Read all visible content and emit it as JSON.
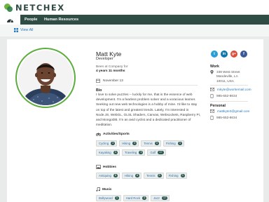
{
  "brand": {
    "name": "NETCHEX"
  },
  "nav": {
    "tabs": [
      "People",
      "Human Resources"
    ]
  },
  "subnav": {
    "view_all": "View All"
  },
  "profile": {
    "name": "Matt Kyte",
    "title": "Developer",
    "tenure_label": "Been at Company for",
    "tenure_value": "4 years 11 months",
    "birthday": "November 13",
    "bio_heading": "Bio",
    "bio": "I love to solve puzzles -- luckily for me, that is the essence of web development. I'm a fearless problem solver and a voracious learner. Seeking out new web technologies is a hobby of mine. I'd like to stay on top of the latest and greatest trends. Lately, I'm interested in Node.JS, WebGL, GLSL Shaders, Canvas, Websockets, Raspberry Pi, and MongoDB. I'm an avid cyclist and a dedicated practitioner of meditation."
  },
  "sections": [
    {
      "heading": "Activities/Sports",
      "icon": "bike-icon",
      "rows": [
        [
          {
            "label": "Cycling",
            "count": "3"
          },
          {
            "label": "Hiking",
            "count": "3"
          },
          {
            "label": "Tennis",
            "count": "3"
          },
          {
            "label": "Fishing",
            "count": "3"
          }
        ],
        [
          {
            "label": "Kayaking",
            "count": "3"
          },
          {
            "label": "Traveling",
            "count": "3"
          },
          {
            "label": "Golf",
            "count": "17"
          }
        ]
      ]
    },
    {
      "heading": "Hobbies",
      "icon": "gallery-icon",
      "rows": [
        [
          {
            "label": "Antiquing",
            "count": "8"
          },
          {
            "label": "Hiking",
            "count": "8"
          },
          {
            "label": "Tennis",
            "count": "8"
          },
          {
            "label": "Fishing",
            "count": "3"
          }
        ]
      ]
    },
    {
      "heading": "Music",
      "icon": "music-note-icon",
      "rows": [
        [
          {
            "label": "Bollywood",
            "count": "3"
          },
          {
            "label": "Hard Rock",
            "count": "3"
          },
          {
            "label": "Jazz",
            "count": "17"
          }
        ]
      ]
    }
  ],
  "social": [
    {
      "name": "twitter-icon",
      "glyph": "t",
      "color": "#2a9fd6"
    },
    {
      "name": "linkedin-icon",
      "glyph": "in",
      "color": "#0e76a8"
    },
    {
      "name": "google-plus-icon",
      "glyph": "g+",
      "color": "#dd4b39"
    },
    {
      "name": "facebook-icon",
      "glyph": "f",
      "color": "#3b5998"
    }
  ],
  "contact": {
    "work_heading": "Work",
    "work_address": [
      "338 West Street",
      "Mandeville, LA",
      "10011, USA"
    ],
    "work_email": "mkyte@workemail.com",
    "work_phone": "985-652-8634",
    "personal_heading": "Personal",
    "personal_email": "mattkyte3@gmail.com",
    "personal_phone": "985-652-8634"
  }
}
